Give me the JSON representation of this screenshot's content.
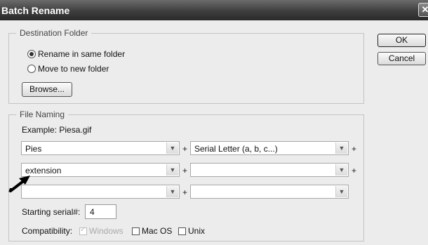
{
  "window": {
    "title": "Batch Rename",
    "close_glyph": "✕"
  },
  "destination": {
    "legend": "Destination Folder",
    "option_same": "Rename in same folder",
    "option_new": "Move to new folder",
    "selected": "same",
    "browse_label": "Browse..."
  },
  "buttons": {
    "ok": "OK",
    "cancel": "Cancel"
  },
  "naming": {
    "legend": "File Naming",
    "example": "Example: Piesa.gif",
    "rows": [
      [
        "Pies",
        "Serial Letter (a, b, c...)"
      ],
      [
        "extension",
        ""
      ],
      [
        "",
        ""
      ]
    ],
    "plus": "+",
    "serial_label": "Starting serial#:",
    "serial_value": "4",
    "compat_label": "Compatibility:",
    "compat": [
      {
        "label": "Windows",
        "checked": true,
        "disabled": true
      },
      {
        "label": "Mac OS",
        "checked": false,
        "disabled": false
      },
      {
        "label": "Unix",
        "checked": false,
        "disabled": false
      }
    ]
  },
  "icons": {
    "dropdown": "chevron-down-icon",
    "pointer": "arrow-annotation-icon"
  },
  "colors": {
    "titlebar": "#3e3e3e",
    "dialog_bg": "#ececec",
    "disabled_text": "#aaaaaa"
  }
}
